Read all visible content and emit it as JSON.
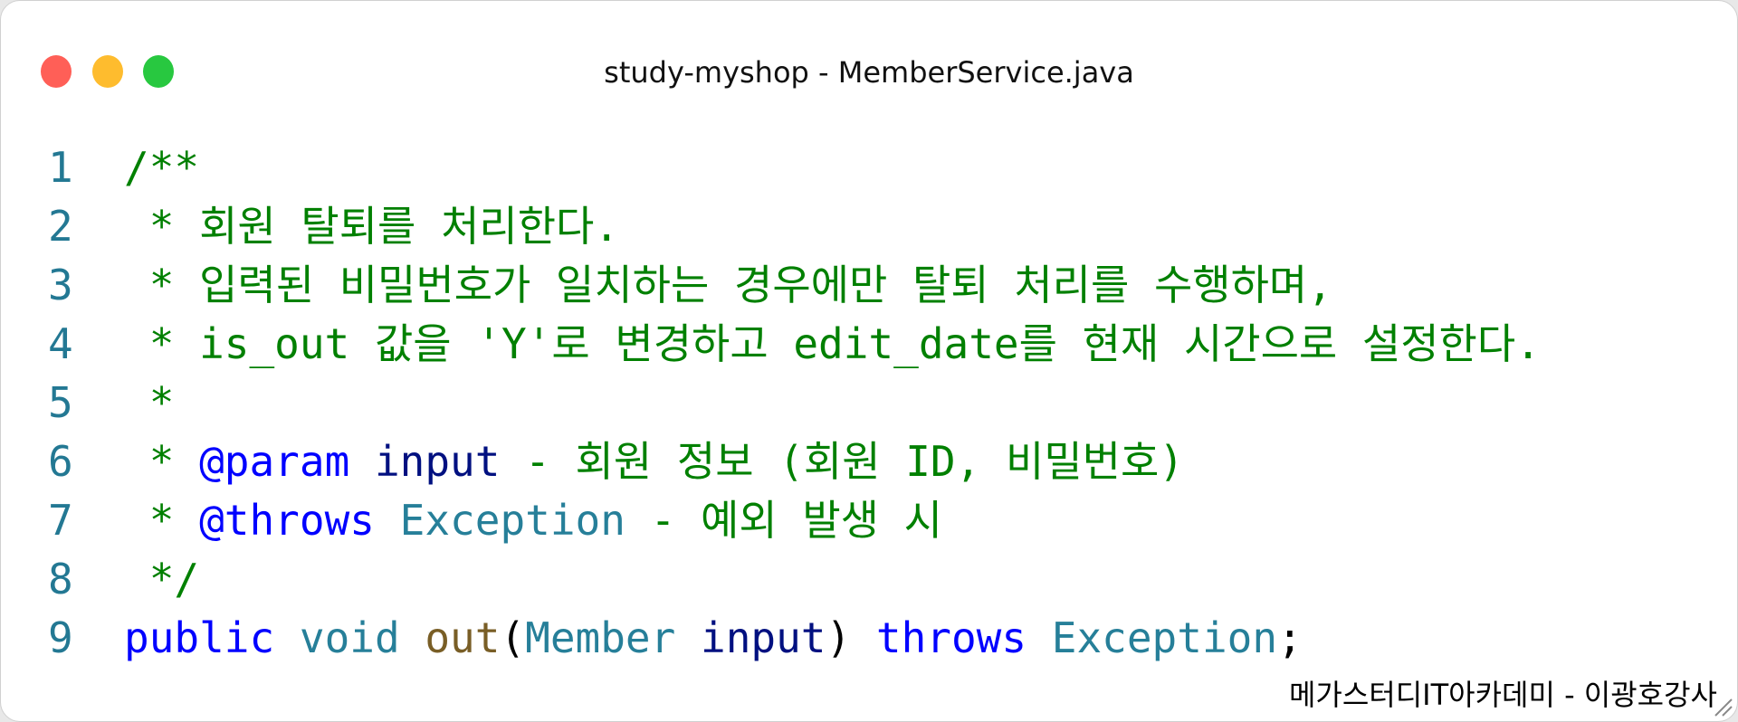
{
  "window": {
    "title": "study-myshop - MemberService.java",
    "controls": {
      "close_color": "#ff5f57",
      "minimize_color": "#febc2e",
      "maximize_color": "#28c840"
    }
  },
  "code": {
    "lines": [
      {
        "n": "1",
        "tokens": [
          {
            "t": "/**",
            "c": "c"
          }
        ]
      },
      {
        "n": "2",
        "tokens": [
          {
            "t": " * 회원 탈퇴를 처리한다.",
            "c": "c"
          }
        ]
      },
      {
        "n": "3",
        "tokens": [
          {
            "t": " * 입력된 비밀번호가 일치하는 경우에만 탈퇴 처리를 수행하며,",
            "c": "c"
          }
        ]
      },
      {
        "n": "4",
        "tokens": [
          {
            "t": " * is_out 값을 'Y'로 변경하고 edit_date를 현재 시간으로 설정한다.",
            "c": "c"
          }
        ]
      },
      {
        "n": "5",
        "tokens": [
          {
            "t": " *",
            "c": "c"
          }
        ]
      },
      {
        "n": "6",
        "tokens": [
          {
            "t": " * ",
            "c": "c"
          },
          {
            "t": "@param",
            "c": "k"
          },
          {
            "t": " ",
            "c": "c"
          },
          {
            "t": "input",
            "c": "v"
          },
          {
            "t": " - 회원 정보 (회원 ID, 비밀번호)",
            "c": "c"
          }
        ]
      },
      {
        "n": "7",
        "tokens": [
          {
            "t": " * ",
            "c": "c"
          },
          {
            "t": "@throws",
            "c": "k"
          },
          {
            "t": " ",
            "c": "c"
          },
          {
            "t": "Exception",
            "c": "t"
          },
          {
            "t": " - 예외 발생 시",
            "c": "c"
          }
        ]
      },
      {
        "n": "8",
        "tokens": [
          {
            "t": " */",
            "c": "c"
          }
        ]
      },
      {
        "n": "9",
        "tokens": [
          {
            "t": "public",
            "c": "k"
          },
          {
            "t": " ",
            "c": "p"
          },
          {
            "t": "void",
            "c": "t"
          },
          {
            "t": " ",
            "c": "p"
          },
          {
            "t": "out",
            "c": "f"
          },
          {
            "t": "(",
            "c": "p"
          },
          {
            "t": "Member",
            "c": "t"
          },
          {
            "t": " ",
            "c": "p"
          },
          {
            "t": "input",
            "c": "v"
          },
          {
            "t": ") ",
            "c": "p"
          },
          {
            "t": "throws",
            "c": "k"
          },
          {
            "t": " ",
            "c": "p"
          },
          {
            "t": "Exception",
            "c": "t"
          },
          {
            "t": ";",
            "c": "p"
          }
        ]
      }
    ]
  },
  "footer": {
    "credit": "메가스터디IT아카데미 - 이광호강사"
  }
}
